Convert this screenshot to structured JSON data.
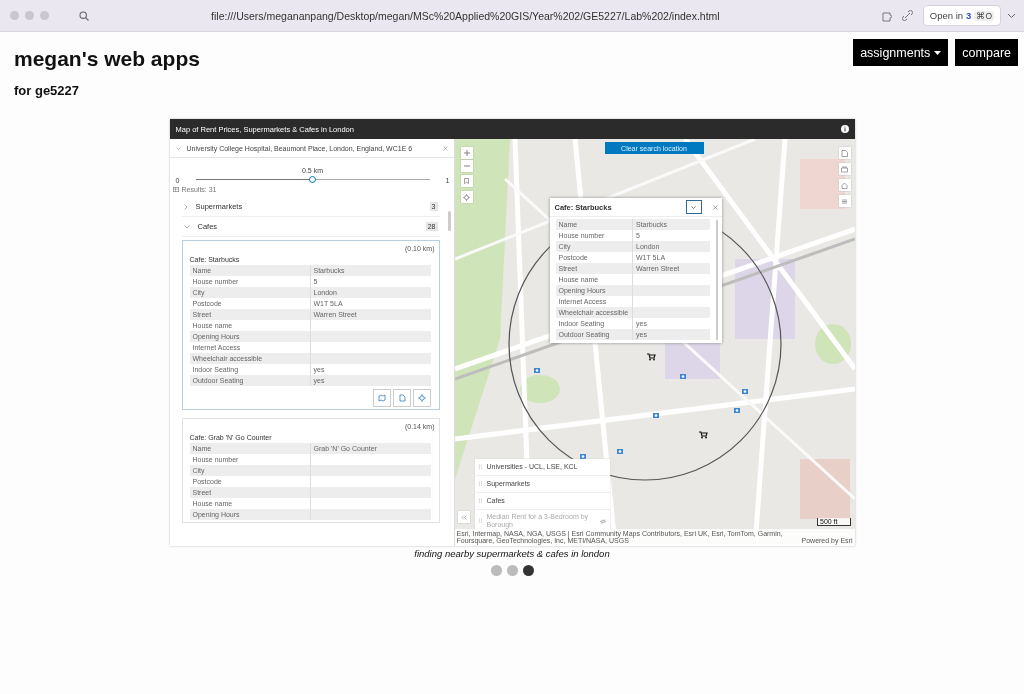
{
  "browser": {
    "url": "file:///Users/megananpang/Desktop/megan/MSc%20Applied%20GIS/Year%202/GE5227/Lab%202/index.html",
    "open_in": {
      "label": "Open in",
      "count": "3",
      "shortcut": "⌘O"
    }
  },
  "page": {
    "title": "megan's web apps",
    "subtitle": "for ge5227",
    "nav_buttons": [
      {
        "label": "assignments",
        "dropdown": true
      },
      {
        "label": "compare",
        "dropdown": false
      }
    ]
  },
  "slide": {
    "app": {
      "title": "Map of Rent Prices, Supermarkets & Cafes in London",
      "search": {
        "value": "University College Hospital, Beaumont Place, London, England, WC1E 6"
      },
      "radius": {
        "label": "0.5 km",
        "min": "0",
        "max": "1",
        "level": 0.5
      },
      "results_label": "Results: 31",
      "groups": [
        {
          "label": "Supermarkets",
          "count": "3",
          "expanded": false
        },
        {
          "label": "Cafes",
          "count": "28",
          "expanded": true
        }
      ],
      "cards": [
        {
          "distance": "(0.10 km)",
          "title": "Cafe: Starbucks",
          "selected": true,
          "rows": [
            {
              "label": "Name",
              "value": "Starbucks"
            },
            {
              "label": "House number",
              "value": "5"
            },
            {
              "label": "City",
              "value": "London"
            },
            {
              "label": "Postcode",
              "value": "W1T 5LA"
            },
            {
              "label": "Street",
              "value": "Warren Street"
            },
            {
              "label": "House name"
            },
            {
              "label": "Opening Hours"
            },
            {
              "label": "Internet Access"
            },
            {
              "label": "Wheelchair accessible"
            },
            {
              "label": "Indoor Seating",
              "value": "yes"
            },
            {
              "label": "Outdoor Seating",
              "value": "yes"
            }
          ],
          "actions": [
            {
              "kind": "map"
            },
            {
              "kind": "document"
            },
            {
              "kind": "target"
            }
          ]
        },
        {
          "distance": "(0.14 km)",
          "title": "Cafe: Grab 'N' Go Counter",
          "selected": false,
          "rows": [
            {
              "label": "Name",
              "value": "Grab 'N' Go Counter"
            },
            {
              "label": "House number"
            },
            {
              "label": "City"
            },
            {
              "label": "Postcode"
            },
            {
              "label": "Street"
            },
            {
              "label": "House name"
            },
            {
              "label": "Opening Hours"
            }
          ]
        }
      ],
      "map": {
        "banner": "Clear search location",
        "popup": {
          "title": "Cafe: Starbucks",
          "rows": [
            {
              "label": "Name",
              "value": "Starbucks"
            },
            {
              "label": "House number",
              "value": "5"
            },
            {
              "label": "City",
              "value": "London"
            },
            {
              "label": "Postcode",
              "value": "W1T 5LA"
            },
            {
              "label": "Street",
              "value": "Warren Street"
            },
            {
              "label": "House name"
            },
            {
              "label": "Opening Hours"
            },
            {
              "label": "Internet Access"
            },
            {
              "label": "Wheelchair accessible"
            },
            {
              "label": "Indoor Seating",
              "value": "yes"
            },
            {
              "label": "Outdoor Seating",
              "value": "yes"
            }
          ]
        },
        "layers": [
          {
            "label": "Universities - UCL, LSE, KCL",
            "visible": true
          },
          {
            "label": "Supermarkets",
            "visible": true
          },
          {
            "label": "Cafes",
            "visible": true
          },
          {
            "label": "Median Rent for a 3-Bedroom by Borough",
            "visible": false
          }
        ],
        "scale": "500 ft",
        "attribution": "Esri, Intermap, NASA, NGA, USGS | Esri Community Maps Contributors, Esri UK, Esri, TomTom, Garmin, Foursquare, GeoTechnologies, Inc, METI/NASA, USGS",
        "powered_by": "Powered by Esri"
      }
    },
    "caption": "finding nearby supermarkets & cafes in london",
    "dots": [
      {
        "selected": false
      },
      {
        "selected": false
      },
      {
        "selected": true
      }
    ]
  }
}
